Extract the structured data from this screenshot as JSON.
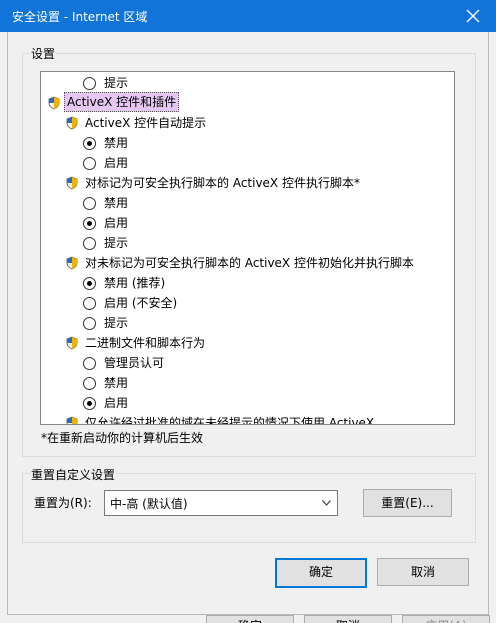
{
  "window": {
    "title": "安全设置 - Internet 区域",
    "close_icon": "close-icon"
  },
  "settings_group": {
    "label": "设置",
    "tree": {
      "partial_top_item": "提示",
      "category": "ActiveX 控件和插件",
      "sections": [
        {
          "label": "ActiveX 控件自动提示",
          "options": [
            {
              "label": "禁用",
              "selected": true
            },
            {
              "label": "启用",
              "selected": false
            }
          ]
        },
        {
          "label": "对标记为可安全执行脚本的 ActiveX 控件执行脚本*",
          "options": [
            {
              "label": "禁用",
              "selected": false
            },
            {
              "label": "启用",
              "selected": true
            },
            {
              "label": "提示",
              "selected": false
            }
          ]
        },
        {
          "label": "对未标记为可安全执行脚本的 ActiveX 控件初始化并执行脚本",
          "options": [
            {
              "label": "禁用 (推荐)",
              "selected": true
            },
            {
              "label": "启用 (不安全)",
              "selected": false
            },
            {
              "label": "提示",
              "selected": false
            }
          ]
        },
        {
          "label": "二进制文件和脚本行为",
          "options": [
            {
              "label": "管理员认可",
              "selected": false
            },
            {
              "label": "禁用",
              "selected": false
            },
            {
              "label": "启用",
              "selected": true
            }
          ]
        }
      ],
      "partial_bottom_item": "仅允许经过批准的域在未经提示的情况下使用 ActiveX"
    },
    "note": "*在重新启动你的计算机后生效"
  },
  "reset_group": {
    "label": "重置自定义设置",
    "reset_to_label": "重置为(R):",
    "dropdown_value": "中-高 (默认值)",
    "reset_button": "重置(E)..."
  },
  "footer": {
    "ok": "确定",
    "cancel": "取消"
  },
  "background_buttons": [
    "确定",
    "取消",
    "应用(A)"
  ],
  "colors": {
    "titlebar": "#1174d9",
    "selection": "#e6c7f2",
    "default_button_border": "#0078d7"
  }
}
